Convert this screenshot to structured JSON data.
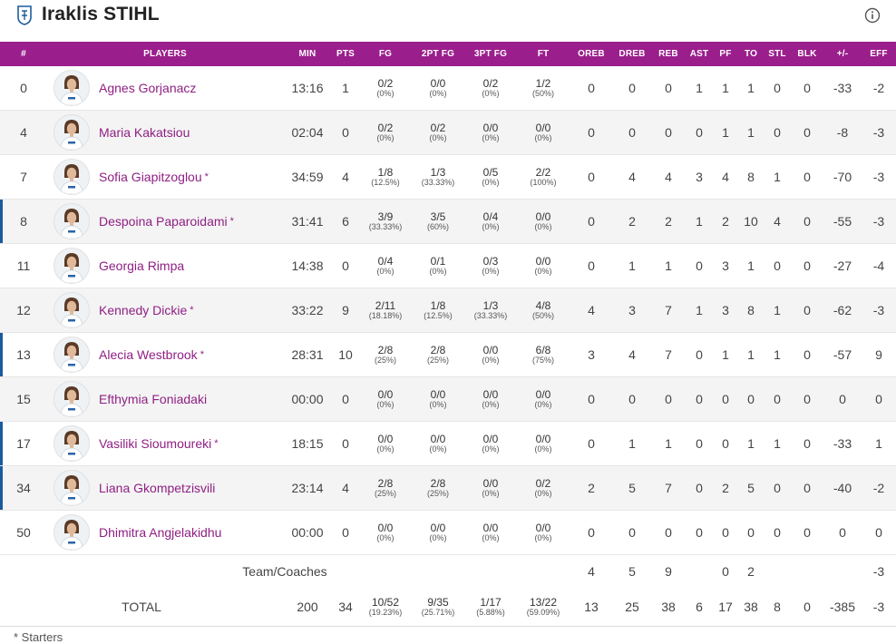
{
  "header": {
    "team_name": "Iraklis STIHL"
  },
  "columns": [
    "#",
    "PLAYERS",
    "MIN",
    "PTS",
    "FG",
    "2PT FG",
    "3PT FG",
    "FT",
    "OREB",
    "DREB",
    "REB",
    "AST",
    "PF",
    "TO",
    "STL",
    "BLK",
    "+/-",
    "EFF"
  ],
  "players": [
    {
      "num": "0",
      "name": "Agnes Gorjanacz",
      "starter": false,
      "marked": false,
      "min": "13:16",
      "pts": "1",
      "fg": [
        "0/2",
        "(0%)"
      ],
      "fg2": [
        "0/0",
        "(0%)"
      ],
      "fg3": [
        "0/2",
        "(0%)"
      ],
      "ft": [
        "1/2",
        "(50%)"
      ],
      "oreb": "0",
      "dreb": "0",
      "reb": "0",
      "ast": "1",
      "pf": "1",
      "to": "1",
      "stl": "0",
      "blk": "0",
      "pm": "-33",
      "eff": "-2"
    },
    {
      "num": "4",
      "name": "Maria Kakatsiou",
      "starter": false,
      "marked": false,
      "min": "02:04",
      "pts": "0",
      "fg": [
        "0/2",
        "(0%)"
      ],
      "fg2": [
        "0/2",
        "(0%)"
      ],
      "fg3": [
        "0/0",
        "(0%)"
      ],
      "ft": [
        "0/0",
        "(0%)"
      ],
      "oreb": "0",
      "dreb": "0",
      "reb": "0",
      "ast": "0",
      "pf": "1",
      "to": "1",
      "stl": "0",
      "blk": "0",
      "pm": "-8",
      "eff": "-3"
    },
    {
      "num": "7",
      "name": "Sofia Giapitzoglou",
      "starter": true,
      "marked": false,
      "min": "34:59",
      "pts": "4",
      "fg": [
        "1/8",
        "(12.5%)"
      ],
      "fg2": [
        "1/3",
        "(33.33%)"
      ],
      "fg3": [
        "0/5",
        "(0%)"
      ],
      "ft": [
        "2/2",
        "(100%)"
      ],
      "oreb": "0",
      "dreb": "4",
      "reb": "4",
      "ast": "3",
      "pf": "4",
      "to": "8",
      "stl": "1",
      "blk": "0",
      "pm": "-70",
      "eff": "-3"
    },
    {
      "num": "8",
      "name": "Despoina Paparoidami",
      "starter": true,
      "marked": true,
      "min": "31:41",
      "pts": "6",
      "fg": [
        "3/9",
        "(33.33%)"
      ],
      "fg2": [
        "3/5",
        "(60%)"
      ],
      "fg3": [
        "0/4",
        "(0%)"
      ],
      "ft": [
        "0/0",
        "(0%)"
      ],
      "oreb": "0",
      "dreb": "2",
      "reb": "2",
      "ast": "1",
      "pf": "2",
      "to": "10",
      "stl": "4",
      "blk": "0",
      "pm": "-55",
      "eff": "-3"
    },
    {
      "num": "11",
      "name": "Georgia Rimpa",
      "starter": false,
      "marked": false,
      "min": "14:38",
      "pts": "0",
      "fg": [
        "0/4",
        "(0%)"
      ],
      "fg2": [
        "0/1",
        "(0%)"
      ],
      "fg3": [
        "0/3",
        "(0%)"
      ],
      "ft": [
        "0/0",
        "(0%)"
      ],
      "oreb": "0",
      "dreb": "1",
      "reb": "1",
      "ast": "0",
      "pf": "3",
      "to": "1",
      "stl": "0",
      "blk": "0",
      "pm": "-27",
      "eff": "-4"
    },
    {
      "num": "12",
      "name": "Kennedy Dickie",
      "starter": true,
      "marked": false,
      "min": "33:22",
      "pts": "9",
      "fg": [
        "2/11",
        "(18.18%)"
      ],
      "fg2": [
        "1/8",
        "(12.5%)"
      ],
      "fg3": [
        "1/3",
        "(33.33%)"
      ],
      "ft": [
        "4/8",
        "(50%)"
      ],
      "oreb": "4",
      "dreb": "3",
      "reb": "7",
      "ast": "1",
      "pf": "3",
      "to": "8",
      "stl": "1",
      "blk": "0",
      "pm": "-62",
      "eff": "-3"
    },
    {
      "num": "13",
      "name": "Alecia Westbrook",
      "starter": true,
      "marked": true,
      "min": "28:31",
      "pts": "10",
      "fg": [
        "2/8",
        "(25%)"
      ],
      "fg2": [
        "2/8",
        "(25%)"
      ],
      "fg3": [
        "0/0",
        "(0%)"
      ],
      "ft": [
        "6/8",
        "(75%)"
      ],
      "oreb": "3",
      "dreb": "4",
      "reb": "7",
      "ast": "0",
      "pf": "1",
      "to": "1",
      "stl": "1",
      "blk": "0",
      "pm": "-57",
      "eff": "9"
    },
    {
      "num": "15",
      "name": "Efthymia Foniadaki",
      "starter": false,
      "marked": false,
      "min": "00:00",
      "pts": "0",
      "fg": [
        "0/0",
        "(0%)"
      ],
      "fg2": [
        "0/0",
        "(0%)"
      ],
      "fg3": [
        "0/0",
        "(0%)"
      ],
      "ft": [
        "0/0",
        "(0%)"
      ],
      "oreb": "0",
      "dreb": "0",
      "reb": "0",
      "ast": "0",
      "pf": "0",
      "to": "0",
      "stl": "0",
      "blk": "0",
      "pm": "0",
      "eff": "0"
    },
    {
      "num": "17",
      "name": "Vasiliki Sioumoureki",
      "starter": true,
      "marked": true,
      "min": "18:15",
      "pts": "0",
      "fg": [
        "0/0",
        "(0%)"
      ],
      "fg2": [
        "0/0",
        "(0%)"
      ],
      "fg3": [
        "0/0",
        "(0%)"
      ],
      "ft": [
        "0/0",
        "(0%)"
      ],
      "oreb": "0",
      "dreb": "1",
      "reb": "1",
      "ast": "0",
      "pf": "0",
      "to": "1",
      "stl": "1",
      "blk": "0",
      "pm": "-33",
      "eff": "1"
    },
    {
      "num": "34",
      "name": "Liana Gkompetzisvili",
      "starter": false,
      "marked": true,
      "min": "23:14",
      "pts": "4",
      "fg": [
        "2/8",
        "(25%)"
      ],
      "fg2": [
        "2/8",
        "(25%)"
      ],
      "fg3": [
        "0/0",
        "(0%)"
      ],
      "ft": [
        "0/2",
        "(0%)"
      ],
      "oreb": "2",
      "dreb": "5",
      "reb": "7",
      "ast": "0",
      "pf": "2",
      "to": "5",
      "stl": "0",
      "blk": "0",
      "pm": "-40",
      "eff": "-2"
    },
    {
      "num": "50",
      "name": "Dhimitra Angjelakidhu",
      "starter": false,
      "marked": false,
      "min": "00:00",
      "pts": "0",
      "fg": [
        "0/0",
        "(0%)"
      ],
      "fg2": [
        "0/0",
        "(0%)"
      ],
      "fg3": [
        "0/0",
        "(0%)"
      ],
      "ft": [
        "0/0",
        "(0%)"
      ],
      "oreb": "0",
      "dreb": "0",
      "reb": "0",
      "ast": "0",
      "pf": "0",
      "to": "0",
      "stl": "0",
      "blk": "0",
      "pm": "0",
      "eff": "0"
    }
  ],
  "team_row": {
    "label": "Team/Coaches",
    "oreb": "4",
    "dreb": "5",
    "reb": "9",
    "ast": "",
    "pf": "0",
    "to": "2",
    "stl": "",
    "blk": "",
    "pm": "",
    "eff": "-3"
  },
  "total_row": {
    "label": "TOTAL",
    "min": "200",
    "pts": "34",
    "fg": [
      "10/52",
      "(19.23%)"
    ],
    "fg2": [
      "9/35",
      "(25.71%)"
    ],
    "fg3": [
      "1/17",
      "(5.88%)"
    ],
    "ft": [
      "13/22",
      "(59.09%)"
    ],
    "oreb": "13",
    "dreb": "25",
    "reb": "38",
    "ast": "6",
    "pf": "17",
    "to": "38",
    "stl": "8",
    "blk": "0",
    "pm": "-385",
    "eff": "-3"
  },
  "footnote": "* Starters",
  "starter_mark": "*",
  "colors": {
    "header_bg": "#9a1f8c",
    "player_link": "#8f1f83",
    "row_marker": "#1a5aa0"
  }
}
